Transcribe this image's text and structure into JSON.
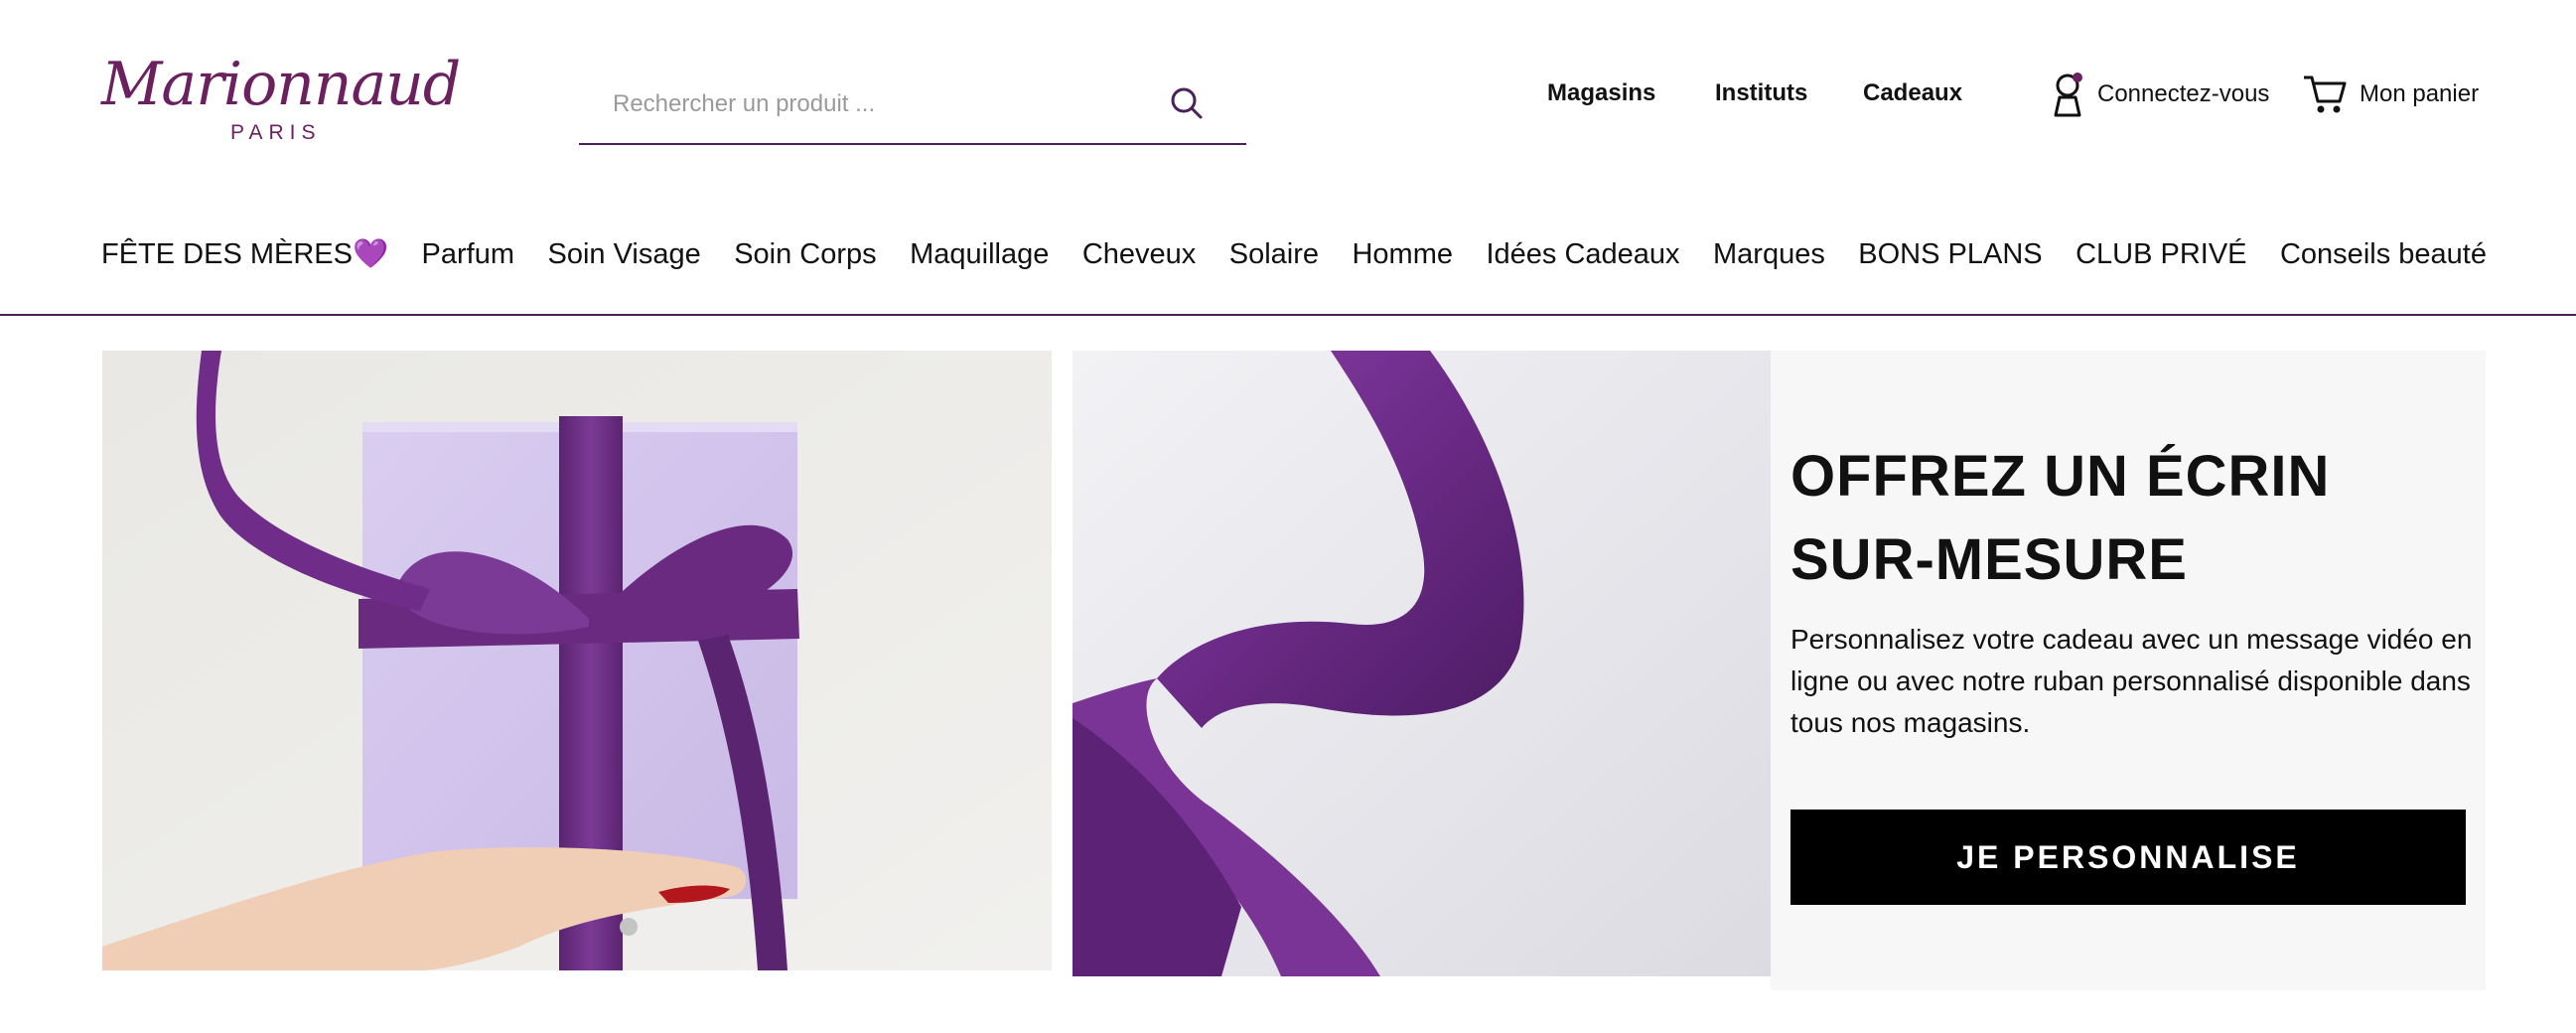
{
  "brand": {
    "name": "Marionnaud",
    "sub": "PARIS",
    "color": "#6b2160"
  },
  "search": {
    "placeholder": "Rechercher un produit ...",
    "value": ""
  },
  "utility": {
    "stores": "Magasins",
    "institutes": "Instituts",
    "gifts": "Cadeaux",
    "login": "Connectez-vous",
    "cart": "Mon panier"
  },
  "nav": [
    {
      "label": "FÊTE DES MÈRES💜"
    },
    {
      "label": "Parfum"
    },
    {
      "label": "Soin Visage"
    },
    {
      "label": "Soin Corps"
    },
    {
      "label": "Maquillage"
    },
    {
      "label": "Cheveux"
    },
    {
      "label": "Solaire"
    },
    {
      "label": "Homme"
    },
    {
      "label": "Idées Cadeaux"
    },
    {
      "label": "Marques"
    },
    {
      "label": "BONS PLANS"
    },
    {
      "label": "CLUB PRIVÉ"
    },
    {
      "label": "Conseils beauté"
    }
  ],
  "promo": {
    "title": "OFFREZ UN ÉCRIN SUR-MESURE",
    "text": "Personnalisez votre cadeau avec un message vidéo en ligne ou avec notre ruban personnalisé disponible dans tous nos magasins.",
    "button": "JE PERSONNALISE"
  },
  "colors": {
    "accent": "#4a2159",
    "ribbon": "#6a2a80",
    "box": "#d6c9ee"
  }
}
